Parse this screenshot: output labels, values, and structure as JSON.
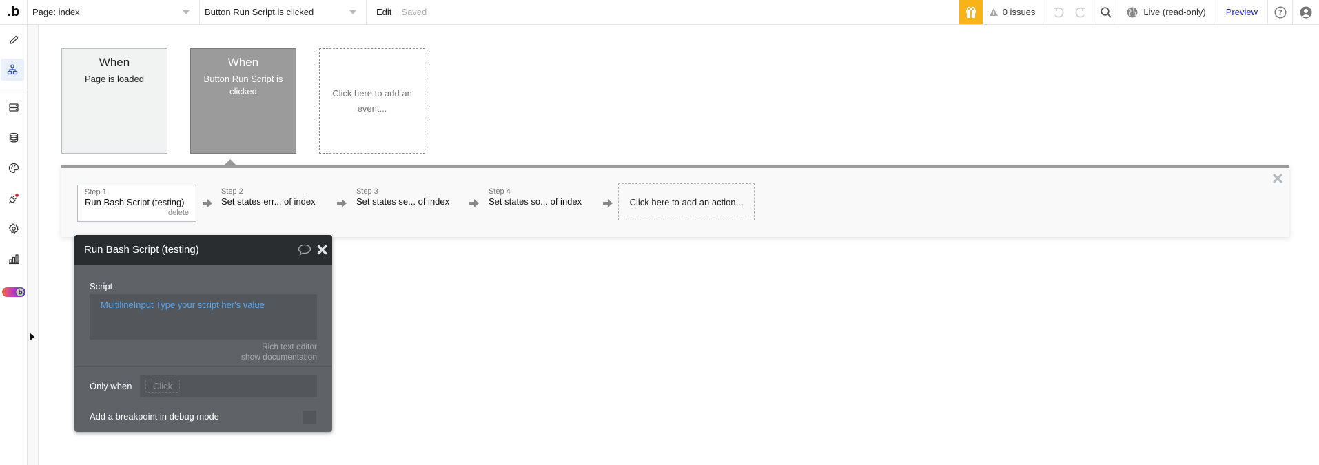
{
  "topbar": {
    "logo": ".b",
    "page_dropdown": "Page: index",
    "event_dropdown": "Button Run Script is clicked",
    "edit_label": "Edit",
    "saved_label": "Saved",
    "issues_label": "0 issues",
    "live_label": "Live (read-only)",
    "preview_label": "Preview",
    "gift_color": "#f8b319"
  },
  "sidebar": {
    "items": [
      {
        "icon": "pencil-icon",
        "label": "Design"
      },
      {
        "icon": "workflow-icon",
        "label": "Workflow",
        "active": true
      },
      {
        "icon": "data-icon",
        "label": "Data"
      },
      {
        "icon": "database-icon",
        "label": "Database"
      },
      {
        "icon": "palette-icon",
        "label": "Styles"
      },
      {
        "icon": "plugin-icon",
        "label": "Plugins"
      },
      {
        "icon": "gear-icon",
        "label": "Settings"
      },
      {
        "icon": "chart-icon",
        "label": "Logs"
      },
      {
        "icon": "toggle-icon",
        "label": "Toggle"
      }
    ]
  },
  "events": [
    {
      "when": "When",
      "description": "Page is loaded",
      "selected": false
    },
    {
      "when": "When",
      "description": "Button Run Script is clicked",
      "selected": true
    }
  ],
  "add_event_label": "Click here to add an event...",
  "steps": [
    {
      "label": "Step 1",
      "title": "Run Bash Script (testing)",
      "delete": "delete",
      "selected": true
    },
    {
      "label": "Step 2",
      "title": "Set states err... of index"
    },
    {
      "label": "Step 3",
      "title": "Set states se... of index"
    },
    {
      "label": "Step 4",
      "title": "Set states so... of index"
    }
  ],
  "add_action_label": "Click here to add an action...",
  "popup": {
    "title": "Run Bash Script (testing)",
    "script_label": "Script",
    "script_value": "MultilineInput Type your script her's value",
    "rich_text_label": "Rich text editor",
    "show_docs_label": "show documentation",
    "only_when_label": "Only when",
    "only_when_placeholder": "Click",
    "breakpoint_label": "Add a breakpoint in debug mode",
    "breakpoint_checked": false,
    "value_color": "#5aa7ee"
  }
}
